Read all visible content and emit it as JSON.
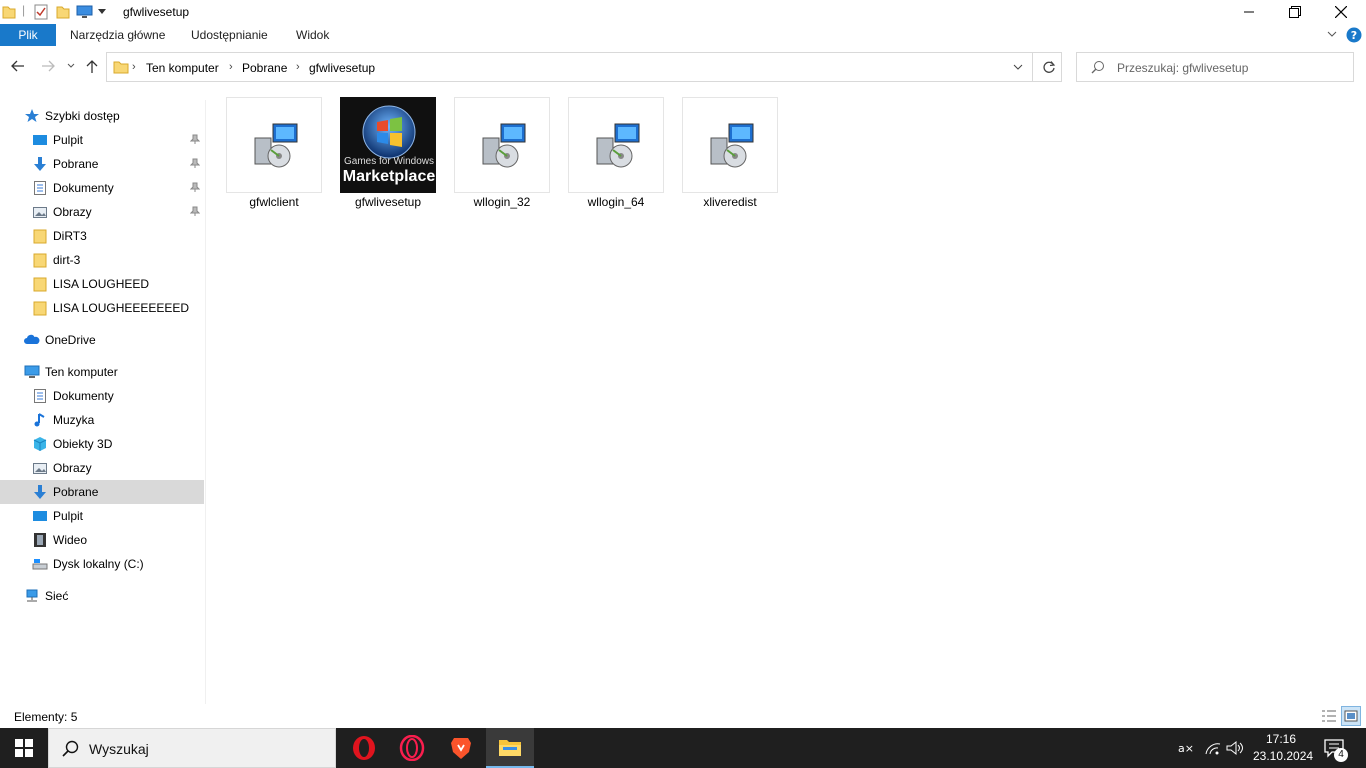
{
  "window": {
    "title": "gfwlivesetup"
  },
  "ribbon": {
    "tabs": [
      "Plik",
      "Narzędzia główne",
      "Udostępnianie",
      "Widok"
    ]
  },
  "address": {
    "crumbs": [
      "Ten komputer",
      "Pobrane",
      "gfwlivesetup"
    ],
    "search_placeholder": "Przeszukaj: gfwlivesetup"
  },
  "nav": {
    "quick_access": "Szybki dostęp",
    "quick_items": [
      "Pulpit",
      "Pobrane",
      "Dokumenty",
      "Obrazy",
      "DiRT3",
      "dirt-3",
      "LISA LOUGHEED",
      "LISA LOUGHEEEEEEED"
    ],
    "onedrive": "OneDrive",
    "this_pc": "Ten komputer",
    "pc_items": [
      "Dokumenty",
      "Muzyka",
      "Obiekty 3D",
      "Obrazy",
      "Pobrane",
      "Pulpit",
      "Wideo",
      "Dysk lokalny (C:)"
    ],
    "network": "Sieć"
  },
  "files": [
    {
      "name": "gfwlclient",
      "icon": "installer-icon"
    },
    {
      "name": "gfwlivesetup",
      "icon": "games-for-windows-marketplace-thumbnail",
      "thumb_top": "Games for Windows",
      "thumb_bottom": "Marketplace"
    },
    {
      "name": "wllogin_32",
      "icon": "installer-icon"
    },
    {
      "name": "wllogin_64",
      "icon": "installer-icon"
    },
    {
      "name": "xliveredist",
      "icon": "installer-icon"
    }
  ],
  "status": {
    "count": "Elementy: 5"
  },
  "taskbar": {
    "search": "Wyszukaj",
    "time": "17:16",
    "date": "23.10.2024",
    "notifications": "4"
  },
  "colors": {
    "accent": "#1979ca",
    "selection": "#d9d9d9",
    "taskbar": "#1f1f1f"
  }
}
